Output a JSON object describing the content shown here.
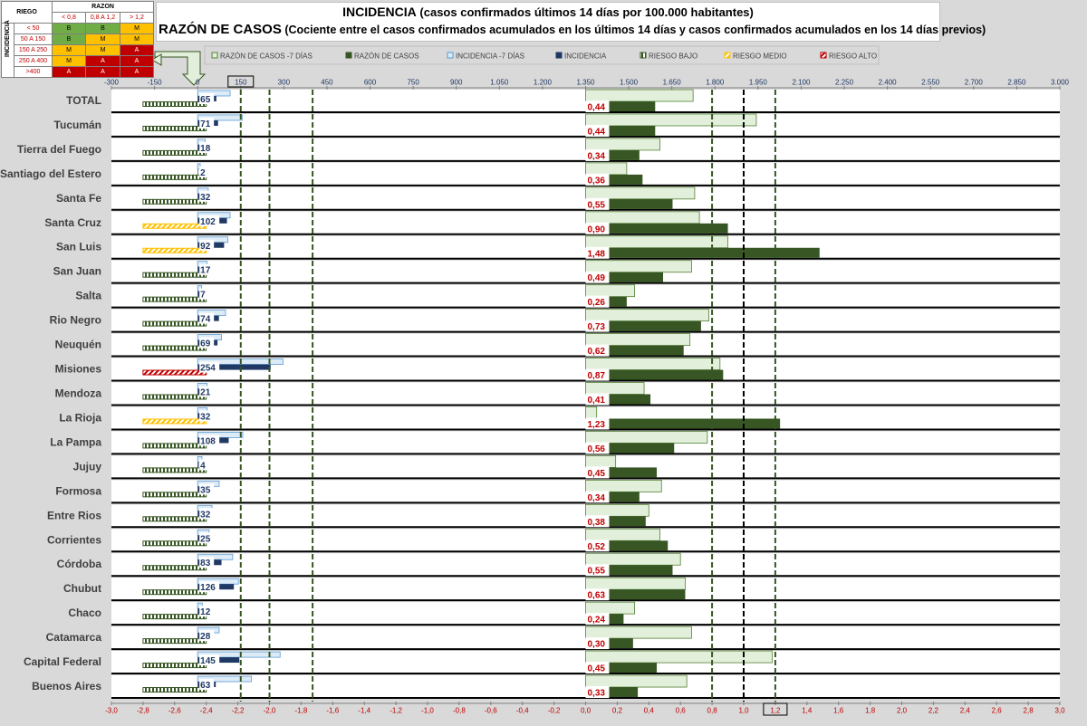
{
  "title": {
    "main": "INCIDENCIA",
    "main_sub": "(casos confirmados últimos 14 días por 100.000 habitantes)",
    "second": "RAZÓN DE CASOS",
    "second_sub": "(Cociente entre el casos confirmados acumulados en los últimos 14 días y casos confirmados acumulados en los 14 días previos)"
  },
  "risk_table": {
    "riesgo": "RIEGO",
    "razon": "RAZON",
    "incidencia": "INCIDENCIA",
    "cols": [
      "< 0,8",
      "0,8 A 1,2",
      "> 1,2"
    ],
    "rows": [
      {
        "label": "< 50",
        "cells": [
          "B",
          "B",
          "M"
        ]
      },
      {
        "label": "50 A 150",
        "cells": [
          "B",
          "M",
          "M"
        ]
      },
      {
        "label": "150 A 250",
        "cells": [
          "M",
          "M",
          "A"
        ]
      },
      {
        "label": "250 A 400",
        "cells": [
          "M",
          "A",
          "A"
        ]
      },
      {
        "label": ">400",
        "cells": [
          "A",
          "A",
          "A"
        ]
      }
    ],
    "colors": {
      "B": "#70ad47",
      "M": "#ffc000",
      "A": "#c00000"
    }
  },
  "colors": {
    "razon_7": "#e2efda",
    "razon_7_border": "#548235",
    "razon": "#375623",
    "incidencia_7": "#ddebf7",
    "incidencia_7_border": "#5b9bd5",
    "incidencia": "#1f3864",
    "riesgo_bajo": "#375623",
    "riesgo_medio": "#ffc000",
    "riesgo_alto": "#c00000",
    "ref_line": "#375623",
    "top_axis_text": "#1f3864",
    "bottom_axis_text": "#c00000",
    "background": "#d9d9d9"
  },
  "chart_data": {
    "type": "bar",
    "legend_position": "top",
    "series": [
      {
        "name": "RAZÓN DE CASOS -7 DÍAS"
      },
      {
        "name": "RAZÓN DE CASOS"
      },
      {
        "name": "INCIDENCIA -7 DÍAS"
      },
      {
        "name": "INCIDENCIA"
      },
      {
        "name": "RIESGO BAJO"
      },
      {
        "name": "RIESGO MEDIO"
      },
      {
        "name": "RIESGO ALTO"
      }
    ],
    "categories": [
      "TOTAL",
      "Tucumán",
      "Tierra del Fuego",
      "Santiago del Estero",
      "Santa Fe",
      "Santa Cruz",
      "San Luis",
      "San Juan",
      "Salta",
      "Rio Negro",
      "Neuquén",
      "Misiones",
      "Mendoza",
      "La Rioja",
      "La Pampa",
      "Jujuy",
      "Formosa",
      "Entre Rios",
      "Corrientes",
      "Córdoba",
      "Chubut",
      "Chaco",
      "Catamarca",
      "Capital Federal",
      "Buenos Aires"
    ],
    "incidencia": [
      65,
      71,
      18,
      2,
      32,
      102,
      92,
      17,
      7,
      74,
      69,
      254,
      21,
      32,
      108,
      4,
      35,
      32,
      25,
      83,
      126,
      12,
      28,
      145,
      63
    ],
    "incidencia_7": [
      113,
      155,
      26,
      9,
      37,
      113,
      105,
      33,
      14,
      97,
      83,
      297,
      33,
      33,
      157,
      15,
      75,
      50,
      40,
      122,
      142,
      16,
      75,
      287,
      187
    ],
    "razon": [
      0.44,
      0.44,
      0.34,
      0.36,
      0.55,
      0.9,
      1.48,
      0.49,
      0.26,
      0.73,
      0.62,
      0.87,
      0.41,
      1.23,
      0.56,
      0.45,
      0.34,
      0.38,
      0.52,
      0.55,
      0.63,
      0.24,
      0.3,
      0.45,
      0.33
    ],
    "razon_7": [
      0.68,
      1.08,
      0.47,
      0.26,
      0.69,
      0.72,
      0.9,
      0.67,
      0.31,
      0.78,
      0.66,
      0.85,
      0.37,
      0.07,
      0.77,
      0.19,
      0.48,
      0.4,
      0.47,
      0.6,
      0.63,
      0.31,
      0.67,
      1.18,
      0.64
    ],
    "riesgo": [
      "BAJO",
      "BAJO",
      "BAJO",
      "BAJO",
      "BAJO",
      "MEDIO",
      "MEDIO",
      "BAJO",
      "BAJO",
      "BAJO",
      "BAJO",
      "ALTO",
      "BAJO",
      "MEDIO",
      "BAJO",
      "BAJO",
      "BAJO",
      "BAJO",
      "BAJO",
      "BAJO",
      "BAJO",
      "BAJO",
      "BAJO",
      "BAJO",
      "BAJO"
    ],
    "incidencia_data_labels": [
      "65",
      "71",
      "18",
      "2",
      "32",
      "102",
      "92",
      "17",
      "7",
      "74",
      "69",
      "254",
      "21",
      "32",
      "108",
      "4",
      "35",
      "32",
      "25",
      "83",
      "126",
      "12",
      "28",
      "145",
      "63"
    ],
    "razon_data_labels": [
      "0,44",
      "0,44",
      "0,34",
      "0,36",
      "0,55",
      "0,90",
      "1,48",
      "0,49",
      "0,26",
      "0,73",
      "0,62",
      "0,87",
      "0,41",
      "1,23",
      "0,56",
      "0,45",
      "0,34",
      "0,38",
      "0,52",
      "0,55",
      "0,63",
      "0,24",
      "0,30",
      "0,45",
      "0,33"
    ],
    "top_axis": {
      "min": -300,
      "max": 3000,
      "ticks": [
        "-300",
        "-150",
        "0",
        "150",
        "300",
        "450",
        "600",
        "750",
        "900",
        "1.050",
        "1.200",
        "1.350",
        "1.500",
        "1.650",
        "1.800",
        "1.950",
        "2.100",
        "2.250",
        "2.400",
        "2.550",
        "2.700",
        "2.850",
        "3.000"
      ],
      "highlighted_tick": "150"
    },
    "bottom_axis": {
      "min": -3.0,
      "max": 3.0,
      "ticks": [
        "-3,0",
        "-2,8",
        "-2,6",
        "-2,4",
        "-2,2",
        "-2,0",
        "-1,8",
        "-1,6",
        "-1,4",
        "-1,2",
        "-1,0",
        "-0,8",
        "-0,6",
        "-0,4",
        "-0,2",
        "0,0",
        "0,2",
        "0,4",
        "0,6",
        "0,8",
        "1,0",
        "1,2",
        "1,4",
        "1,6",
        "1,8",
        "2,0",
        "2,2",
        "2,4",
        "2,6",
        "2,8",
        "3,0"
      ],
      "highlighted_tick": "1,2"
    },
    "reference_lines": {
      "incidencia": [
        150,
        250,
        400
      ],
      "razon": [
        0.8,
        1.2
      ],
      "razon_black": [
        1.0
      ]
    },
    "gridlines": false
  }
}
